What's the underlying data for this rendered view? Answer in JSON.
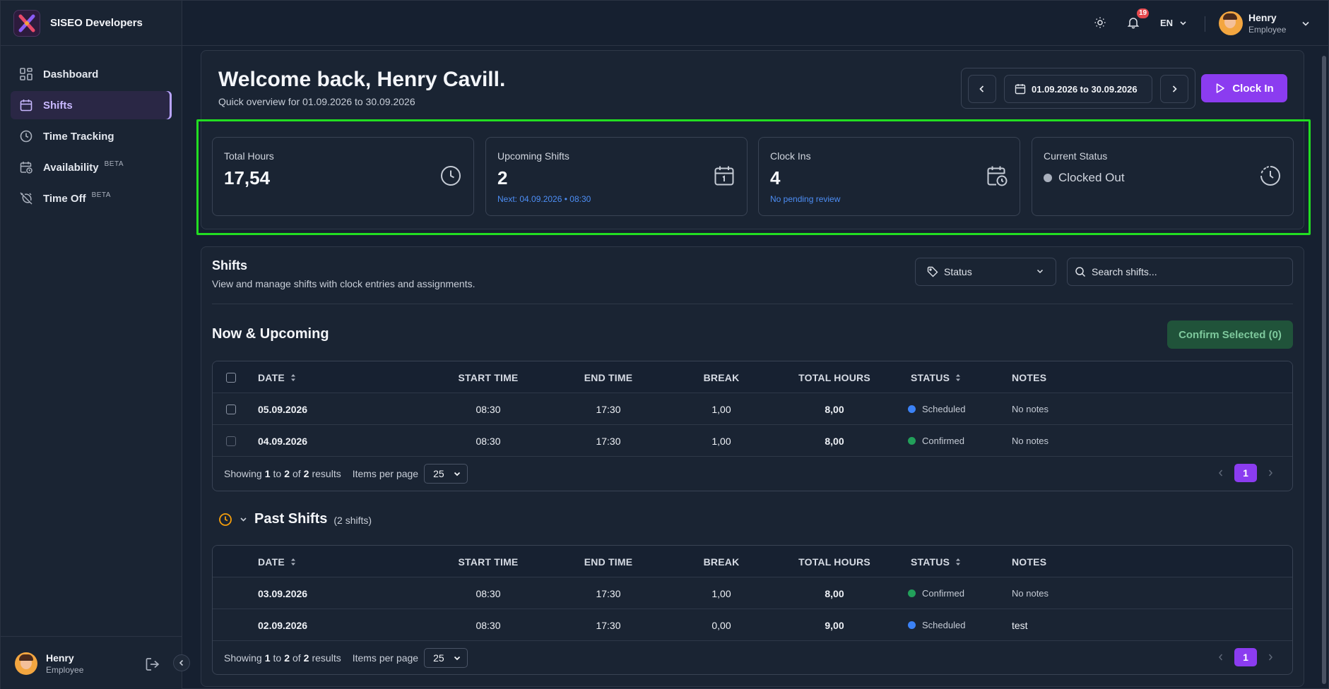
{
  "brand": {
    "name": "SISEO Developers"
  },
  "sidebar": {
    "items": [
      {
        "label": "Dashboard",
        "icon": "dashboard-icon"
      },
      {
        "label": "Shifts",
        "icon": "calendar-icon",
        "active": true
      },
      {
        "label": "Time Tracking",
        "icon": "clock-icon"
      },
      {
        "label": "Availability",
        "icon": "calendar-clock-icon",
        "badge": "BETA"
      },
      {
        "label": "Time Off",
        "icon": "alarm-off-icon",
        "badge": "BETA"
      }
    ],
    "footer": {
      "name": "Henry",
      "role": "Employee"
    }
  },
  "topbar": {
    "notification_count": "19",
    "language": "EN",
    "user": {
      "name": "Henry",
      "role": "Employee"
    }
  },
  "welcome": {
    "title": "Welcome back, Henry Cavill.",
    "subtitle": "Quick overview for 01.09.2026 to 30.09.2026",
    "date_range": "01.09.2026 to 30.09.2026",
    "clock_in_label": "Clock In"
  },
  "stats": [
    {
      "label": "Total Hours",
      "value": "17,54",
      "note": ""
    },
    {
      "label": "Upcoming Shifts",
      "value": "2",
      "note": "Next: 04.09.2026 • 08:30"
    },
    {
      "label": "Clock Ins",
      "value": "4",
      "note": "No pending review"
    },
    {
      "label": "Current Status",
      "value": "Clocked Out",
      "note": ""
    }
  ],
  "shifts": {
    "title": "Shifts",
    "description": "View and manage shifts with clock entries and assignments.",
    "status_filter": "Status",
    "search_placeholder": "Search shifts...",
    "columns": [
      "DATE",
      "START TIME",
      "END TIME",
      "BREAK",
      "TOTAL HOURS",
      "STATUS",
      "NOTES"
    ],
    "upcoming": {
      "title": "Now & Upcoming",
      "confirm_label": "Confirm Selected (0)",
      "rows": [
        {
          "date": "05.09.2026",
          "start": "08:30",
          "end": "17:30",
          "break": "1,00",
          "total": "8,00",
          "status": "Scheduled",
          "notes": "No notes"
        },
        {
          "date": "04.09.2026",
          "start": "08:30",
          "end": "17:30",
          "break": "1,00",
          "total": "8,00",
          "status": "Confirmed",
          "notes": "No notes"
        }
      ],
      "footer": {
        "showing": "Showing",
        "from": "1",
        "to_word": "to",
        "to": "2",
        "of_word": "of",
        "total": "2",
        "results": "results",
        "per_page_label": "Items per page",
        "per_page": "25",
        "page": "1"
      }
    },
    "past": {
      "title": "Past Shifts",
      "count": "(2 shifts)",
      "rows": [
        {
          "date": "03.09.2026",
          "start": "08:30",
          "end": "17:30",
          "break": "1,00",
          "total": "8,00",
          "status": "Confirmed",
          "notes": "No notes"
        },
        {
          "date": "02.09.2026",
          "start": "08:30",
          "end": "17:30",
          "break": "0,00",
          "total": "9,00",
          "status": "Scheduled",
          "notes": "test"
        }
      ],
      "footer": {
        "showing": "Showing",
        "from": "1",
        "to_word": "to",
        "to": "2",
        "of_word": "of",
        "total": "2",
        "results": "results",
        "per_page_label": "Items per page",
        "per_page": "25",
        "page": "1"
      }
    }
  },
  "colors": {
    "accent": "#8b3cf0",
    "scheduled": "#3b82f6",
    "confirmed": "#22a05a",
    "highlight": "#22dd22"
  }
}
